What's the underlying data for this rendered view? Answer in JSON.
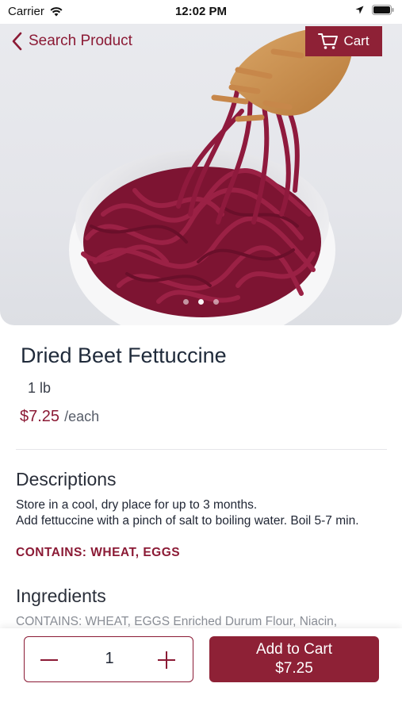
{
  "status_bar": {
    "carrier": "Carrier",
    "time": "12:02 PM"
  },
  "header": {
    "back_label": "Search Product",
    "cart_label": "Cart"
  },
  "product": {
    "name": "Dried Beet Fettuccine",
    "size": "1 lb",
    "price": "$7.25",
    "price_unit": "/each",
    "image_pages": 3,
    "active_image": 2
  },
  "descriptions": {
    "title": "Descriptions",
    "line1": "Store in a cool, dry place for up to 3 months.",
    "line2": "Add fettuccine with a pinch of salt to boiling water. Boil 5-7 min.",
    "allergens": "CONTAINS: WHEAT, EGGS"
  },
  "ingredients": {
    "title": "Ingredients",
    "text": "CONTAINS: WHEAT, EGGS Enriched Durum Flour, Niacin,"
  },
  "cart_bar": {
    "quantity": "1",
    "add_label": "Add to Cart",
    "add_price": "$7.25"
  },
  "colors": {
    "accent": "#8e2136",
    "pasta": "#8a1838"
  }
}
